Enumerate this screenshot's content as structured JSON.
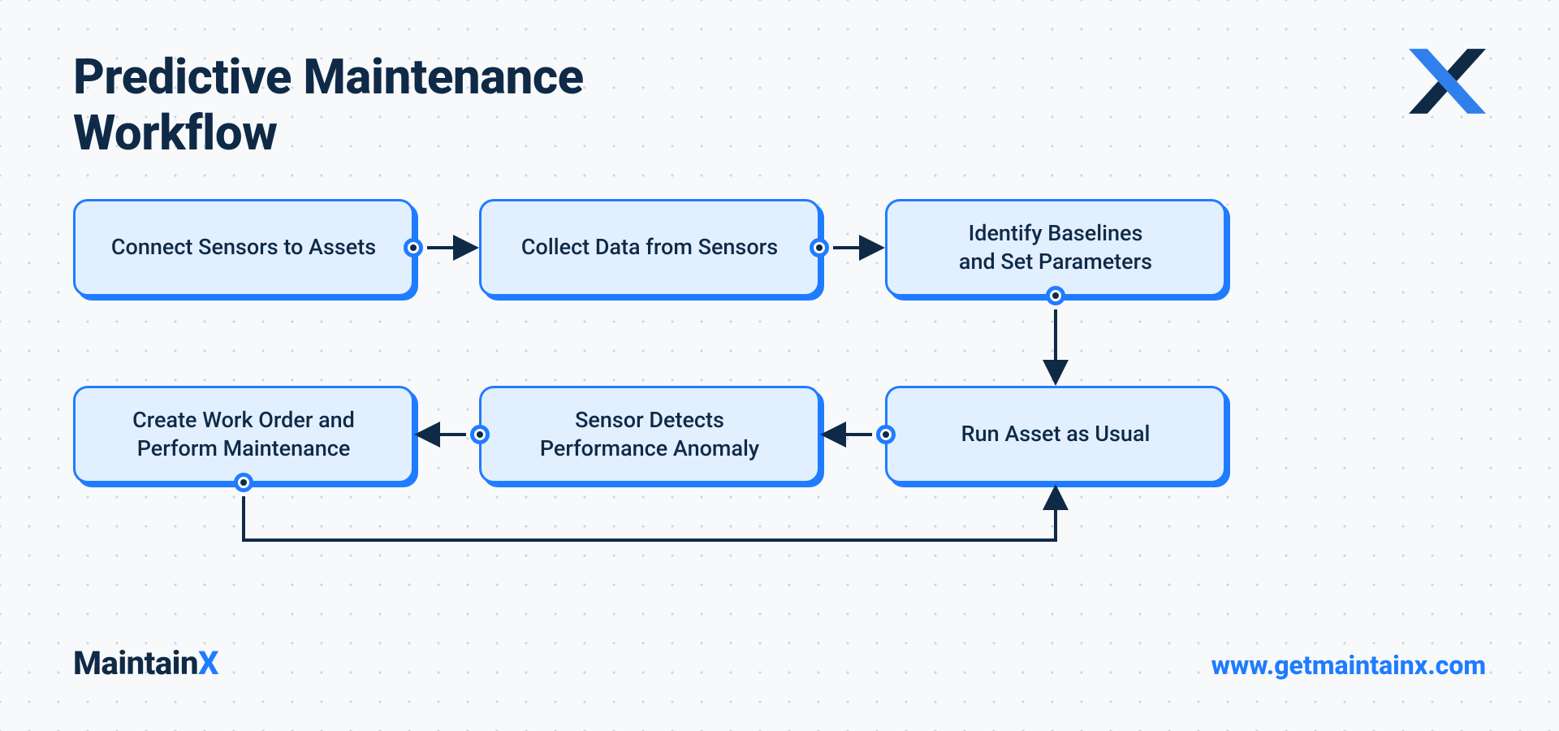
{
  "title_line1": "Predictive Maintenance",
  "title_line2": "Workflow",
  "nodes": {
    "n1": "Connect Sensors to Assets",
    "n2": "Collect Data from Sensors",
    "n3_l1": "Identify Baselines",
    "n3_l2": "and Set Parameters",
    "n4": "Run Asset as Usual",
    "n5_l1": "Sensor Detects",
    "n5_l2": "Performance Anomaly",
    "n6_l1": "Create Work Order and",
    "n6_l2": "Perform Maintenance"
  },
  "brand": {
    "name_main": "Maintain",
    "name_accent": "X",
    "url": "www.getmaintainx.com"
  },
  "colors": {
    "accent": "#1f7cff",
    "dark": "#0f2a47",
    "node_bg": "#e2efff"
  }
}
